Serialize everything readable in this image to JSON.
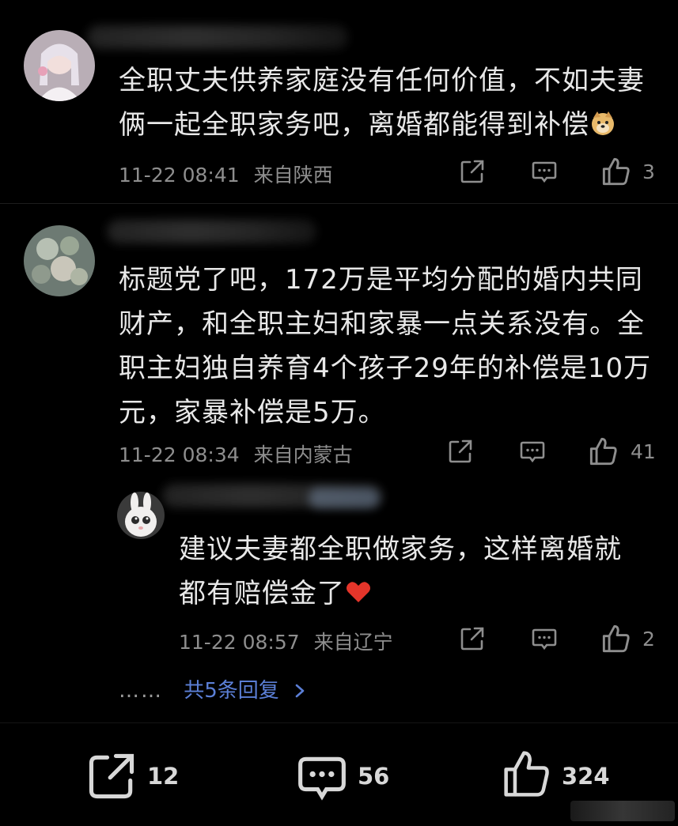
{
  "comments": [
    {
      "text_line1": "全职丈夫供养家庭没有任何价值，不如夫妻",
      "text_line2": "俩一起全职家务吧，离婚都能得到补偿",
      "emoji": "doge-emoji",
      "time": "11-22 08:41",
      "location": "来自陕西",
      "likes": "3"
    },
    {
      "text_line1": "标题党了吧，172万是平均分配的婚内共同",
      "text_line2": "财产，和全职主妇和家暴一点关系没有。全",
      "text_line3": "职主妇独自养育4个孩子29年的补偿是10万",
      "text_line4": "元，家暴补偿是5万。",
      "time": "11-22 08:34",
      "location": "来自内蒙古",
      "likes": "41"
    },
    {
      "text_line1": "建议夫妻都全职做家务，这样离婚就",
      "text_line2": "都有赔偿金了",
      "emoji": "red-heart-emoji",
      "time": "11-22 08:57",
      "location": "来自辽宁",
      "likes": "2"
    }
  ],
  "replies_link": "共5条回复",
  "replies_dots": "……",
  "bottom_bar": {
    "shares": "12",
    "comments": "56",
    "likes": "324"
  },
  "colors": {
    "background": "#000000",
    "text": "#e8e8e8",
    "meta": "#8e8e8e",
    "link": "#5b7fd6"
  },
  "icons": [
    "share-icon",
    "comment-icon",
    "like-icon",
    "chevron-right-icon"
  ]
}
